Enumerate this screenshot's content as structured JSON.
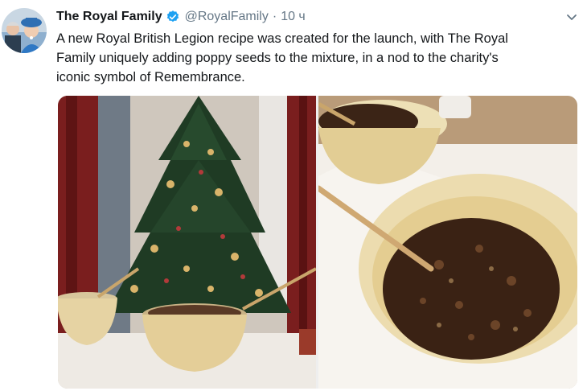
{
  "tweet": {
    "display_name": "The Royal Family",
    "handle": "@RoyalFamily",
    "separator": "·",
    "time": "10 ч",
    "text_lines": [
      "A new Royal British Legion recipe was created for the launch, with The Royal",
      "Family uniquely adding poppy seeds to the mixture, in a nod to the charity's",
      "iconic symbol of Remembrance."
    ],
    "icons": {
      "verified": "verified-badge-icon",
      "menu": "chevron-down-icon"
    },
    "colors": {
      "name": "#14171a",
      "meta": "#657786",
      "verified": "#1da1f2"
    },
    "media": [
      {
        "description_icon": "photo-christmas-tree-bowls"
      },
      {
        "description_icon": "photo-pudding-mixture-bowls"
      }
    ]
  }
}
